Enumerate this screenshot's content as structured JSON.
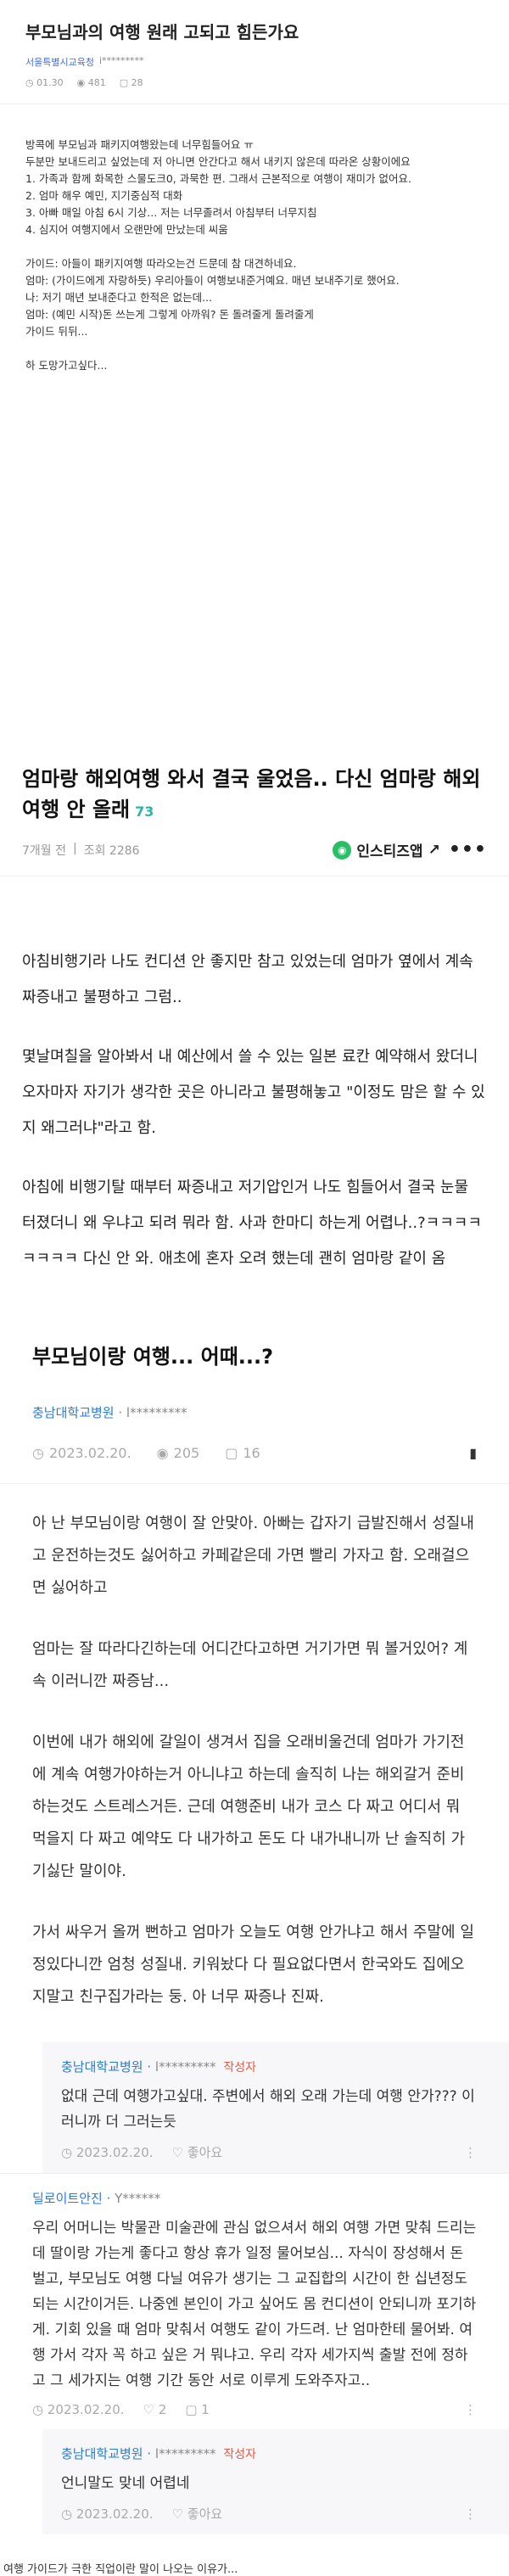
{
  "post1": {
    "title": "부모님과의 여행 원래 고되고 힘든가요",
    "school": "서울특별시교육청",
    "user": "i*********",
    "time": "01.30",
    "views": "481",
    "comments": "28",
    "body": [
      "방콕에 부모님과 패키지여행왔는데 너무힘들어요 ㅠ\n두분만 보내드리고 싶었는데 저 아니면 안간다고 해서 내키지 않은데 따라온 상황이에요\n1. 가족과 함께 화목한 스물도크0, 과묵한 편. 그래서 근본적으로 여행이 재미가 없어요.\n2. 엄마 해우 예민, 지기중심적 대화\n3. 아빠 매일 아침 6시 기상... 저는 너무졸려서 아침부터 너무지침\n4. 심지어 여행지에서 오랜만에 만났는데 씨움",
      "가이드: 아들이 패키지여행 따라오는건 드문데 참 대견하네요.\n엄마: (가이드에게 자랑하듯) 우리아들이 여행보내준거예요. 매년 보내주기로 했어요.\n나: 저기 매년 보내준다고 한적은 없는데...\n엄마: (예민 시작)돈 쓰는게 그렇게 아까워? 돈 돌려줄게 돌려줄게\n가이드 뒤뒤...",
      "하 도망가고싶다..."
    ]
  },
  "post2": {
    "title": "엄마랑 해외여행 와서 결국 울었음.. 다신 엄마랑 해외 여행 안 올래",
    "count": "73",
    "time": "7개월 전",
    "views": "조회 2286",
    "insta_label": "인스티즈앱",
    "paragraphs": [
      "아침비행기라 나도 컨디션 안 좋지만 참고 있었는데 엄마가 옆에서 계속 짜증내고 불평하고 그럼..",
      "몇날며칠을 알아봐서 내 예산에서 쓸 수 있는 일본 료칸 예약해서 왔더니 오자마자 자기가 생각한 곳은 아니라고 불평해놓고 \"이정도 맘은 할 수 있지 왜그러냐\"라고 함.",
      "아침에 비행기탈 때부터 짜증내고 저기압인거 나도 힘들어서 결국 눈물 터졌더니 왜 우냐고 되려 뭐라 함. 사과 한마디 하는게 어렵나..?ㅋㅋㅋㅋㅋㅋㅋㅋ 다신 안 와. 애초에 혼자 오려 했는데 괜히 엄마랑 같이 옴"
    ]
  },
  "post3": {
    "title": "부모님이랑 여행... 어때...?",
    "school": "충남대학교병원",
    "user": "l*********",
    "date": "2023.02.20.",
    "views": "205",
    "comments": "16",
    "paragraphs": [
      "아 난 부모님이랑 여행이 잘 안맞아. 아빠는 갑자기 급발진해서 성질내고 운전하는것도 싫어하고 카페같은데 가면 빨리 가자고 함. 오래걸으면 싫어하고",
      "엄마는 잘 따라다긴하는데 어디간다고하면 거기가면 뭐 볼거있어? 계속 이러니깐 짜증남...",
      "이번에 내가 해외에 갈일이 생겨서 집을 오래비울건데 엄마가 가기전에 계속 여행가야하는거 아니냐고 하는데 솔직히 나는 해외갈거 준비하는것도 스트레스거든. 근데 여행준비 내가 코스 다 짜고 어디서 뭐 먹을지 다 짜고 예약도 다 내가하고 돈도 다 내가내니까 난 솔직히 가기싫단 말이야.",
      "가서 싸우거 올꺼 뻔하고 엄마가 오늘도 여행 안가냐고 해서 주말에 일정있다니깐 엄청 성질내. 키워놨다 다 필요없다면서 한국와도 집에오지말고 친구집가라는 둥. 아 너무 짜증나 진짜."
    ]
  },
  "comments": [
    {
      "school": "충남대학교병원",
      "user": "l*********",
      "writer": "작성자",
      "text": "없대 근데 여행가고싶대. 주변에서 해외 오래 가는데 여행 안가??? 이러니까 더 그러는듯",
      "date": "2023.02.20.",
      "like": "좋아요",
      "reply": true
    },
    {
      "school": "딜로이트안진",
      "user": "Y******",
      "writer": "",
      "text": "우리 어머니는 박물관 미술관에 관심 없으셔서 해외 여행 가면 맞춰 드리는데 딸이랑 가는게 좋다고 항상 휴가 일정 물어보심... 자식이 장성해서 돈 벌고, 부모님도 여행 다닐 여유가 생기는 그 교집합의 시간이 한 십년정도 되는 시간이거든. 나중엔 본인이 가고 싶어도 몸 컨디션이 안되니까 포기하게. 기회 있을 때 엄마 맞춰서 여행도 같이 가드려. 난 엄마한테 물어봐. 여행 가서 각자 꼭 하고 싶은 거 뭐냐고. 우리 각자 세가지씩 출발 전에 정하고 그 세가지는 여행 기간 동안 서로 이루게 도와주자고..",
      "date": "2023.02.20.",
      "like": "2",
      "replies": "1",
      "reply": false
    },
    {
      "school": "충남대학교병원",
      "user": "l*********",
      "writer": "작성자",
      "text": "언니말도 맞네 어렵네",
      "date": "2023.02.20.",
      "like": "좋아요",
      "reply": true
    }
  ],
  "footer_text": "여행 가이드가 극한 직업이란 말이 나오는 이유가..."
}
